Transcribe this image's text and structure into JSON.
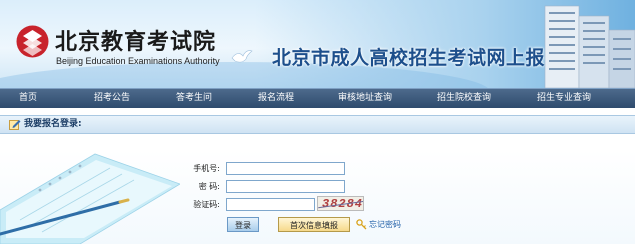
{
  "header": {
    "logo_cn": "北京教育考试院",
    "logo_en": "Beijing Education Examinations Authority",
    "site_title": "北京市成人高校招生考试网上报名"
  },
  "nav": {
    "items": [
      {
        "label": "首页"
      },
      {
        "label": "招考公告"
      },
      {
        "label": "答考生问"
      },
      {
        "label": "报名流程"
      },
      {
        "label": "审核地址查询"
      },
      {
        "label": "招生院校查询"
      },
      {
        "label": "招生专业查询"
      }
    ]
  },
  "login": {
    "heading": "我要报名登录:",
    "phone_label": "手机号:",
    "password_label": "密  码:",
    "captcha_label": "验证码:",
    "phone_value": "",
    "password_value": "",
    "captcha_value": "",
    "captcha_text": "38284",
    "login_button": "登录",
    "first_time_button": "首次信息填报",
    "forgot_link": "忘记密码"
  },
  "colors": {
    "nav_bg": "#3a5778",
    "title_blue": "#1d4f8c",
    "link_blue": "#1f5fa8"
  }
}
